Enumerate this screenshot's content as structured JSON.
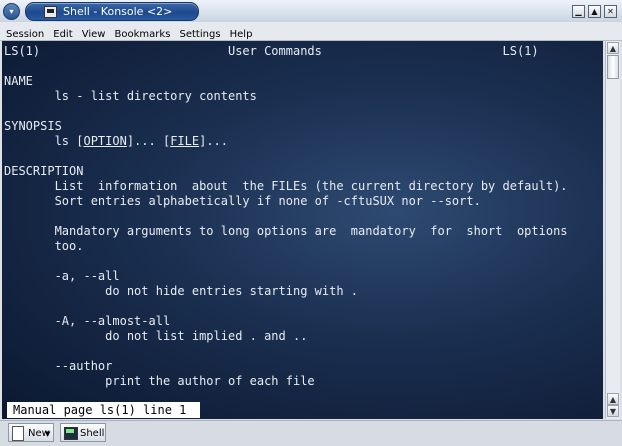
{
  "window": {
    "title": "Shell - Konsole <2>",
    "buttons": [
      "minimize-icon",
      "maximize-icon",
      "close-icon"
    ]
  },
  "menubar": [
    "Session",
    "Edit",
    "View",
    "Bookmarks",
    "Settings",
    "Help"
  ],
  "terminal": {
    "lines": [
      {
        "text": "LS(1)                          User Commands                         LS(1)"
      },
      {
        "text": ""
      },
      {
        "text": ""
      },
      {
        "text": "NAME"
      },
      {
        "text": "       ls - list directory contents"
      },
      {
        "text": ""
      },
      {
        "text": "SYNOPSIS"
      },
      {
        "text": "       ls [OPTION]... [FILE]..."
      },
      {
        "text": ""
      },
      {
        "text": "DESCRIPTION"
      },
      {
        "text": "       List  information  about  the FILEs (the current directory by default)."
      },
      {
        "text": "       Sort entries alphabetically if none of -cftuSUX nor --sort."
      },
      {
        "text": ""
      },
      {
        "text": "       Mandatory arguments to long options are  mandatory  for  short  options"
      },
      {
        "text": "       too."
      },
      {
        "text": ""
      },
      {
        "text": "       -a, --all"
      },
      {
        "text": "              do not hide entries starting with ."
      },
      {
        "text": ""
      },
      {
        "text": "       -A, --almost-all"
      },
      {
        "text": "              do not list implied . and .."
      },
      {
        "text": ""
      },
      {
        "text": "       --author"
      },
      {
        "text": "              print the author of each file"
      }
    ],
    "synopsis_parts": {
      "pre": "       ls [",
      "opt": "OPTION",
      "mid": "]... [",
      "file": "FILE",
      "post": "]..."
    },
    "status": "Manual page ls(1) line 1"
  },
  "taskbar": {
    "new_label": "New",
    "shell_label": "Shell"
  }
}
